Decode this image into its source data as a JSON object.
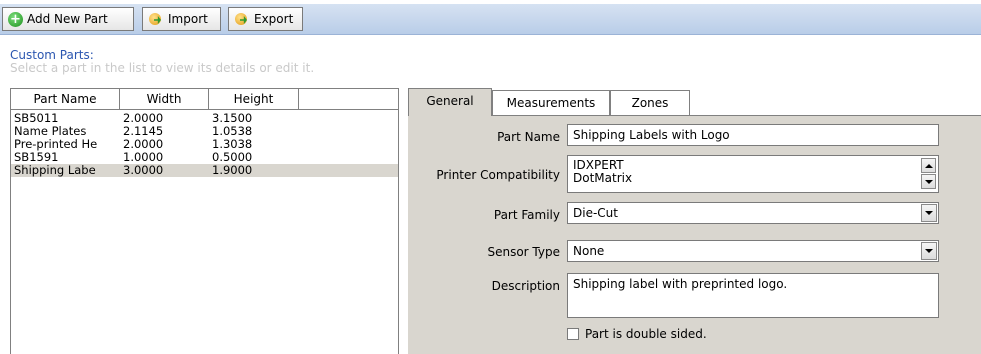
{
  "toolbar": {
    "add_label": "Add New Part",
    "import_label": "Import",
    "export_label": "Export"
  },
  "custom_parts": {
    "title": "Custom Parts:",
    "hint": "Select a part in the list to view its details or edit it."
  },
  "parts_list": {
    "columns": [
      "Part Name",
      "Width",
      "Height",
      ""
    ],
    "rows": [
      {
        "name": "SB5011",
        "width": "2.0000",
        "height": "3.1500"
      },
      {
        "name": "Name Plates",
        "width": "2.1145",
        "height": "1.0538"
      },
      {
        "name": "Pre-printed He",
        "width": "2.0000",
        "height": "1.3038"
      },
      {
        "name": "SB1591",
        "width": "1.0000",
        "height": "0.5000"
      },
      {
        "name": "Shipping Labe",
        "width": "3.0000",
        "height": "1.9000"
      }
    ],
    "selected_index": 4
  },
  "tabs": [
    "General",
    "Measurements",
    "Zones"
  ],
  "active_tab": "General",
  "form": {
    "part_name_label": "Part Name",
    "part_name_value": "Shipping Labels with Logo",
    "printer_compat_label": "Printer Compatibility",
    "printer_compat_items": [
      "IDXPERT",
      "DotMatrix"
    ],
    "part_family_label": "Part Family",
    "part_family_value": "Die-Cut",
    "sensor_type_label": "Sensor Type",
    "sensor_type_value": "None",
    "description_label": "Description",
    "description_value": "Shipping label with preprinted logo.",
    "double_sided_label": "Part is double sided.",
    "double_sided_checked": false
  },
  "colors": {
    "toolbar_strip": "#b9cde8",
    "section_title": "#2b56b0",
    "panel_bg": "#d9d6cf",
    "selected_row": "#d9d6cf"
  }
}
